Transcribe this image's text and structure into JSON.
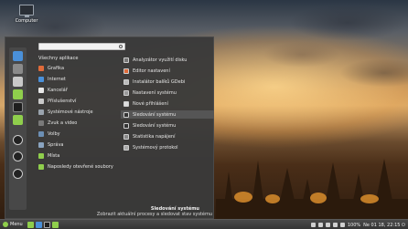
{
  "desktop": {
    "icon_label": "Computer"
  },
  "menu": {
    "search_placeholder": "",
    "categories": [
      {
        "label": "Všechny aplikace",
        "color": "none"
      },
      {
        "label": "Grafika",
        "color": "#e06b3a"
      },
      {
        "label": "Internet",
        "color": "#4a90d9"
      },
      {
        "label": "Kancelář",
        "color": "#e8e8e8"
      },
      {
        "label": "Příslušenství",
        "color": "#c9c9c9"
      },
      {
        "label": "Systémové nástroje",
        "color": "#9aa3ad"
      },
      {
        "label": "Zvuk a video",
        "color": "#7a7a7a"
      },
      {
        "label": "Volby",
        "color": "#6c8fb4"
      },
      {
        "label": "Správa",
        "color": "#8aa4c0"
      },
      {
        "label": "Místa",
        "color": "#8fce4c"
      },
      {
        "label": "Naposledy otevřené soubory",
        "color": "#8fce4c"
      }
    ],
    "apps": [
      {
        "label": "Analyzátor využití disku"
      },
      {
        "label": "Editor nastavení"
      },
      {
        "label": "Instalátor balíků GDebi"
      },
      {
        "label": "Nastavení systému"
      },
      {
        "label": "Nové přihlášení"
      },
      {
        "label": "Sledování systému"
      },
      {
        "label": "Sledování systému"
      },
      {
        "label": "Statistika napájení"
      },
      {
        "label": "Systémový protokol"
      }
    ],
    "selected_app_index": 5,
    "description_title": "Sledování systému",
    "description_text": "Zobrazit aktuální procesy a sledovat stav systému"
  },
  "taskbar": {
    "menu_label": "Menu",
    "battery": "100%",
    "clock": "Ne 01 18, 22:15 ⏻"
  }
}
